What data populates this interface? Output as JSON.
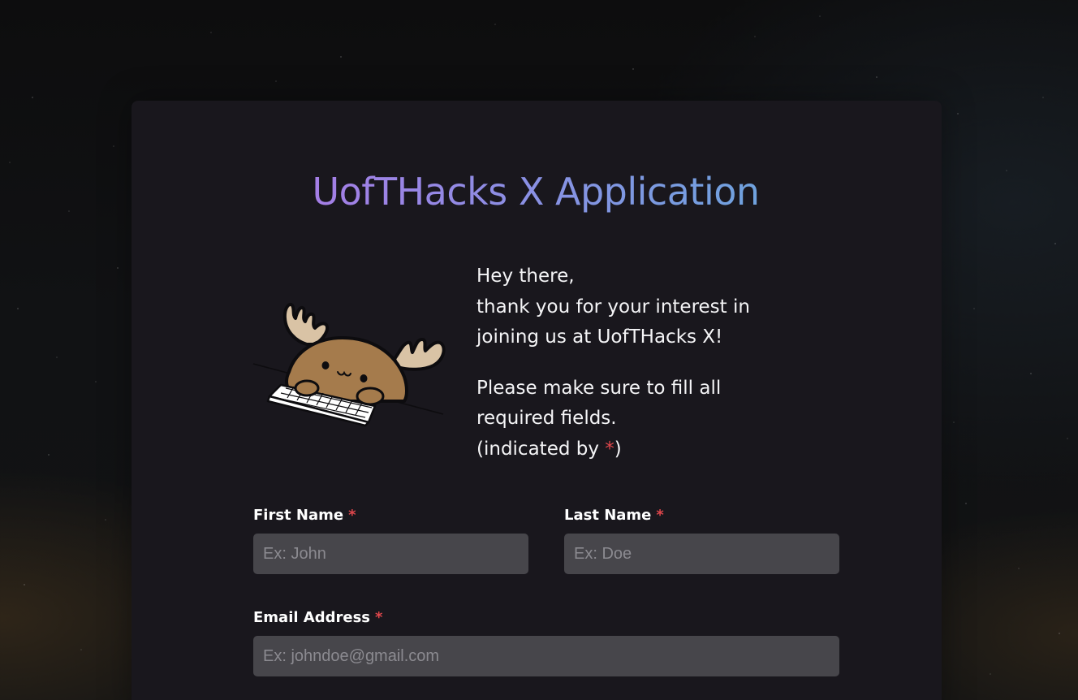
{
  "page": {
    "title": "UofTHacks X Application"
  },
  "intro": {
    "line1": "Hey there,",
    "line2": "thank you for your interest in",
    "line3": "joining us at UofTHacks X!",
    "line4": "Please make sure to fill all",
    "line5": "required fields.",
    "line6_prefix": "(indicated by ",
    "line6_asterisk": "*",
    "line6_suffix": ")"
  },
  "form": {
    "first_name": {
      "label": "First Name",
      "required_marker": "*",
      "value": "",
      "placeholder": "Ex: John"
    },
    "last_name": {
      "label": "Last Name",
      "required_marker": "*",
      "value": "",
      "placeholder": "Ex: Doe"
    },
    "email": {
      "label": "Email Address",
      "required_marker": "*",
      "value": "",
      "placeholder": "Ex: johndoe@gmail.com"
    }
  },
  "colors": {
    "title_gradient_start": "#a57ee6",
    "title_gradient_end": "#6fa2de",
    "required_marker": "#e0474c",
    "card_background": "#19171d",
    "input_background": "#47464b"
  },
  "icons": {
    "mascot": "moose-typing-on-keyboard-illustration"
  }
}
